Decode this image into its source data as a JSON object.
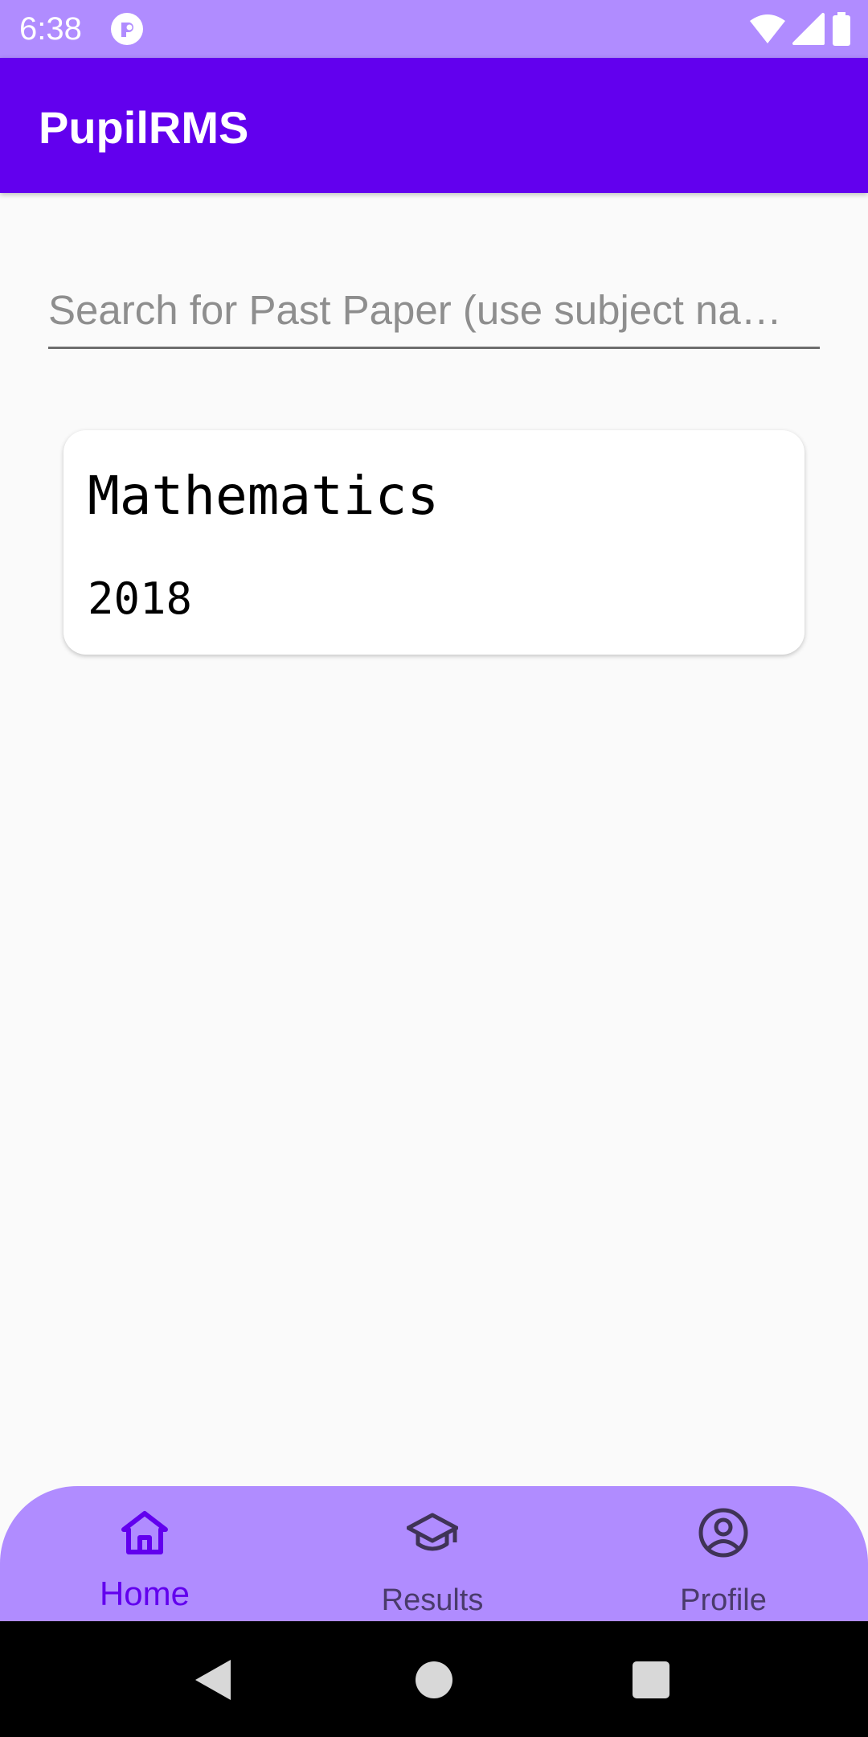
{
  "status_bar": {
    "time": "6:38",
    "icons": [
      "app-notification-icon",
      "wifi-icon",
      "cell-signal-icon",
      "battery-icon"
    ]
  },
  "app_bar": {
    "title": "PupilRMS"
  },
  "search": {
    "placeholder": "Search for Past Paper (use subject na…",
    "value": ""
  },
  "papers": [
    {
      "subject": "Mathematics",
      "year": "2018"
    }
  ],
  "bottom_nav": {
    "items": [
      {
        "label": "Home",
        "icon": "home-icon",
        "active": true
      },
      {
        "label": "Results",
        "icon": "graduation-cap-icon",
        "active": false
      },
      {
        "label": "Profile",
        "icon": "account-circle-icon",
        "active": false
      }
    ]
  },
  "system_nav": {
    "buttons": [
      "back-icon",
      "home-circle-icon",
      "recents-icon"
    ]
  },
  "colors": {
    "primary": "#6200ee",
    "status_bar": "#b08cff",
    "bottom_nav": "#b08cff",
    "background": "#fafafa"
  }
}
